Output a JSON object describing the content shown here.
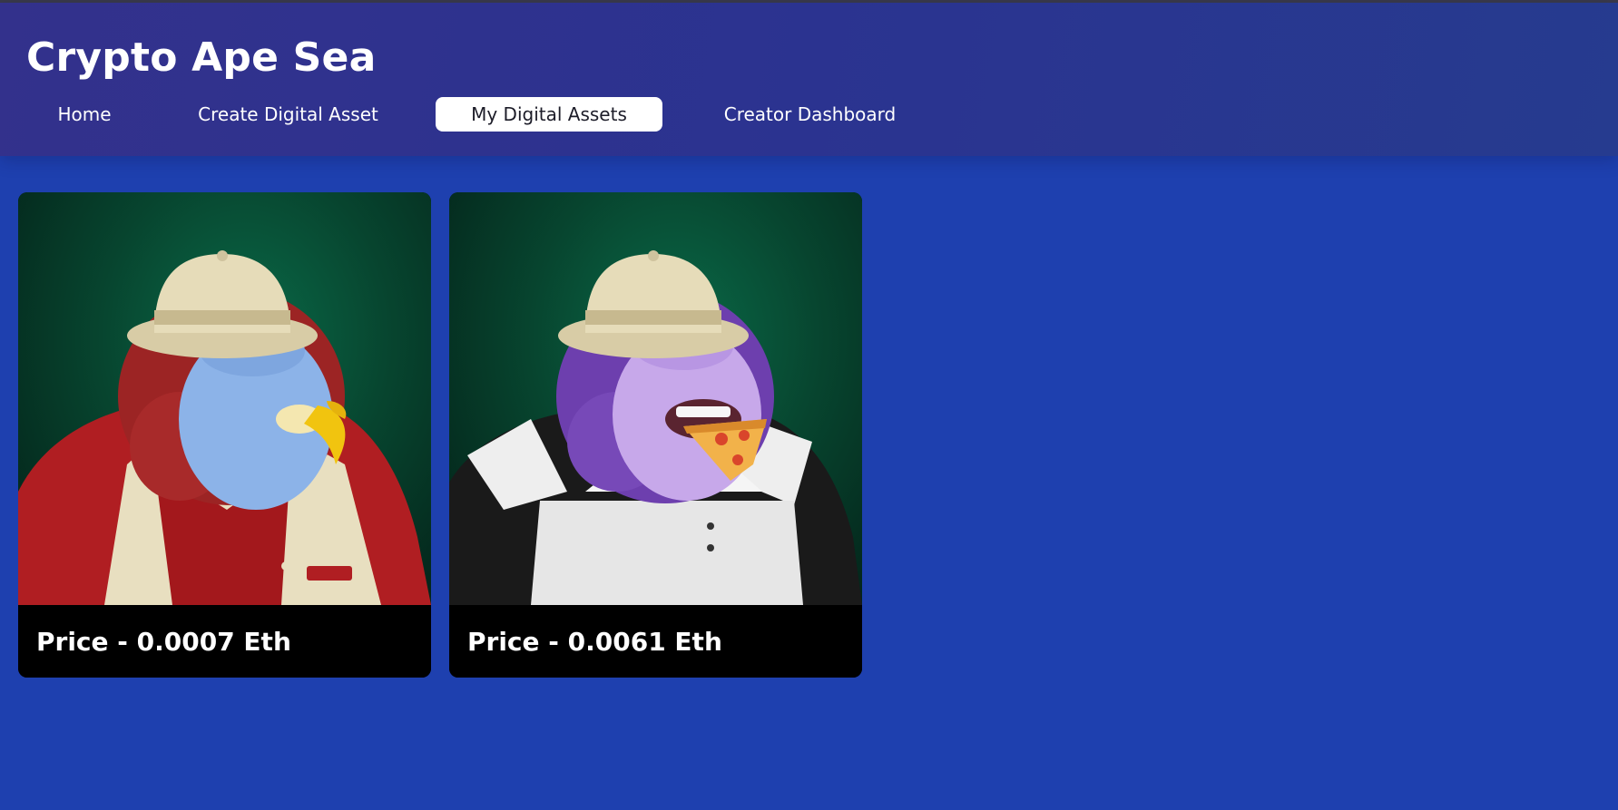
{
  "app": {
    "title": "Crypto Ape Sea"
  },
  "nav": {
    "items": [
      {
        "label": "Home"
      },
      {
        "label": "Create Digital Asset"
      },
      {
        "label": "My Digital Assets",
        "active": true
      },
      {
        "label": "Creator Dashboard"
      }
    ]
  },
  "assets": [
    {
      "price_label": "Price - 0.0007 Eth",
      "image": "ape-with-banana-image"
    },
    {
      "price_label": "Price - 0.0061 Eth",
      "image": "ape-with-pizza-image"
    }
  ],
  "colors": {
    "page_background": "#1e40af",
    "header_background": "#2d3290",
    "active_nav_background": "#ffffff",
    "card_footer": "#000000"
  }
}
